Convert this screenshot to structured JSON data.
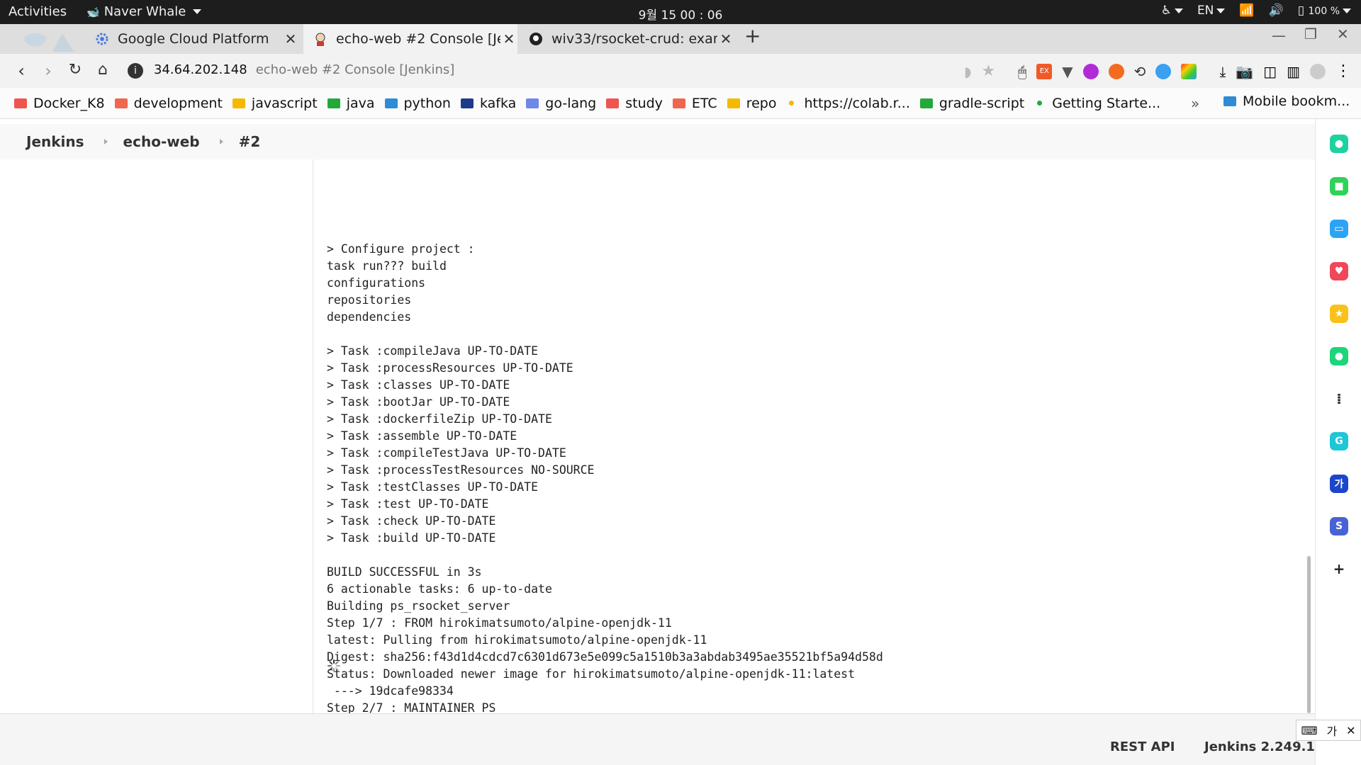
{
  "topbar": {
    "activities": "Activities",
    "app_menu": "Naver Whale",
    "clock": "9월 15  00 : 06",
    "lang": "EN",
    "battery": "100 %"
  },
  "tabs": [
    {
      "title": "Google Cloud Platform",
      "close": "✕"
    },
    {
      "title": "echo-web #2 Console [Jenkins]",
      "close": "✕"
    },
    {
      "title": "wiv33/rsocket-crud: example",
      "close": "✕"
    }
  ],
  "new_tab": "+",
  "address": {
    "host": "34.64.202.148",
    "page_title": "echo-web #2 Console [Jenkins]"
  },
  "bookmarks": [
    {
      "label": "Docker_K8",
      "color": "#f0544f",
      "kind": "folder"
    },
    {
      "label": "development",
      "color": "#f0664f",
      "kind": "folder"
    },
    {
      "label": "javascript",
      "color": "#f6b900",
      "kind": "folder"
    },
    {
      "label": "java",
      "color": "#22a93a",
      "kind": "folder"
    },
    {
      "label": "python",
      "color": "#2f8bd6",
      "kind": "folder"
    },
    {
      "label": "kafka",
      "color": "#1e3a8a",
      "kind": "folder"
    },
    {
      "label": "go-lang",
      "color": "#6f87e8",
      "kind": "folder"
    },
    {
      "label": "study",
      "color": "#f0544f",
      "kind": "folder"
    },
    {
      "label": "ETC",
      "color": "#f0664f",
      "kind": "folder"
    },
    {
      "label": "repo",
      "color": "#f6b900",
      "kind": "folder"
    },
    {
      "label": "https://colab.r...",
      "color": "#f6b900",
      "kind": "dot"
    },
    {
      "label": "gradle-script",
      "color": "#22a93a",
      "kind": "folder"
    },
    {
      "label": "Getting Starte...",
      "color": "#22a93a",
      "kind": "dot"
    }
  ],
  "bookmarks_more": "»",
  "mobile_bookmarks": "Mobile bookm...",
  "breadcrumb": [
    "Jenkins",
    "echo-web",
    "#2"
  ],
  "console_lines": [
    "",
    "> Configure project :",
    "task run??? build",
    "configurations",
    "repositories",
    "dependencies",
    "",
    "> Task :compileJava UP-TO-DATE",
    "> Task :processResources UP-TO-DATE",
    "> Task :classes UP-TO-DATE",
    "> Task :bootJar UP-TO-DATE",
    "> Task :dockerfileZip UP-TO-DATE",
    "> Task :assemble UP-TO-DATE",
    "> Task :compileTestJava UP-TO-DATE",
    "> Task :processTestResources NO-SOURCE",
    "> Task :testClasses UP-TO-DATE",
    "> Task :test UP-TO-DATE",
    "> Task :check UP-TO-DATE",
    "> Task :build UP-TO-DATE",
    "",
    "BUILD SUCCESSFUL in 3s",
    "6 actionable tasks: 6 up-to-date",
    "Building ps_rsocket_server",
    "Step 1/7 : FROM hirokimatsumoto/alpine-openjdk-11",
    "latest: Pulling from hirokimatsumoto/alpine-openjdk-11",
    "Digest: sha256:f43d1d4cdcd7c6301d673e5e099c5a1510b3a3abdab3495ae35521bf5a94d58d",
    "Status: Downloaded newer image for hirokimatsumoto/alpine-openjdk-11:latest",
    " ---> 19dcafe98334",
    "Step 2/7 : MAINTAINER PS"
  ],
  "footer": {
    "rest_api": "REST API",
    "version": "Jenkins 2.249.1"
  },
  "sidebar_icons": [
    {
      "name": "whale-green-icon",
      "color": "#1ed2a0",
      "glyph": "●"
    },
    {
      "name": "green-app-icon",
      "color": "#2fd35a",
      "glyph": "■"
    },
    {
      "name": "calendar-app-icon",
      "color": "#2ba4f5",
      "glyph": "▭"
    },
    {
      "name": "pocket-icon",
      "color": "#f0475a",
      "glyph": "♥"
    },
    {
      "name": "favorites-star-icon",
      "color": "#f8c21a",
      "glyph": "★"
    },
    {
      "name": "notification-app-icon",
      "color": "#1dd57a",
      "glyph": "●"
    },
    {
      "name": "dots-app-icon",
      "color": "#ffffff",
      "glyph": "⁞"
    },
    {
      "name": "translate-app-icon",
      "color": "#1ec6d8",
      "glyph": "G"
    },
    {
      "name": "korean-dict-icon",
      "color": "#1b46c9",
      "glyph": "가"
    },
    {
      "name": "s-app-icon",
      "color": "#4863d6",
      "glyph": "S"
    },
    {
      "name": "add-app-icon",
      "color": "#ffffff",
      "glyph": "+"
    }
  ],
  "ime": {
    "symbol": "⌨",
    "mode": "가",
    "tool": "✕"
  }
}
